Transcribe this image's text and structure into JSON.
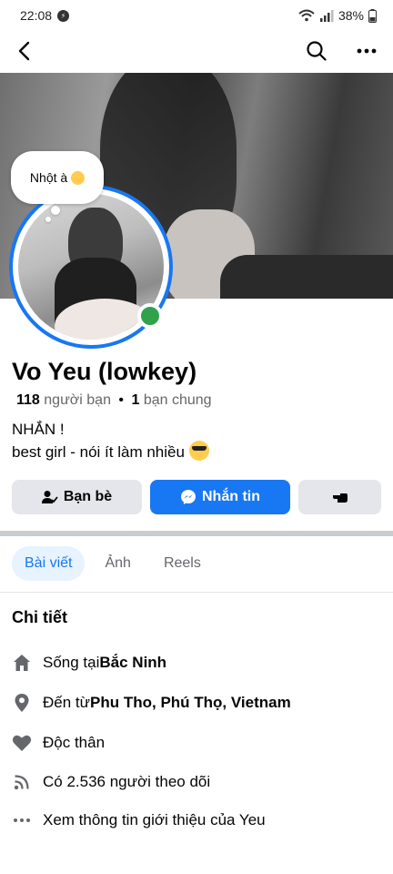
{
  "status": {
    "time": "22:08",
    "battery": "38%"
  },
  "bubble": {
    "text": "Nhột à"
  },
  "profile": {
    "name": "Vo Yeu (lowkey)",
    "friends_count": "118",
    "friends_label": "người bạn",
    "separator": "•",
    "mutual_count": "1",
    "mutual_label": "bạn chung",
    "bio_line1": "NHẮN !",
    "bio_line2": "best girl - nói ít làm nhiều"
  },
  "actions": {
    "friends_button": "Bạn bè",
    "message_button": "Nhắn tin"
  },
  "tabs": [
    {
      "label": "Bài viết",
      "active": true
    },
    {
      "label": "Ảnh",
      "active": false
    },
    {
      "label": "Reels",
      "active": false
    }
  ],
  "details": {
    "title": "Chi tiết",
    "lives_prefix": "Sống tại ",
    "lives_value": "Bắc Ninh",
    "from_prefix": "Đến từ ",
    "from_value": "Phu Tho, Phú Thọ, Vietnam",
    "relationship": "Độc thân",
    "followers": "Có 2.536 người theo dõi",
    "see_about": "Xem thông tin giới thiệu của Yeu"
  },
  "colors": {
    "accent": "#1877f2",
    "online": "#31a24c",
    "muted": "#65676b"
  },
  "icons": [
    "back-arrow-icon",
    "search-icon",
    "more-icon",
    "home-icon",
    "location-pin-icon",
    "heart-icon",
    "rss-icon",
    "dots-icon",
    "friend-icon",
    "messenger-icon",
    "hand-icon"
  ]
}
